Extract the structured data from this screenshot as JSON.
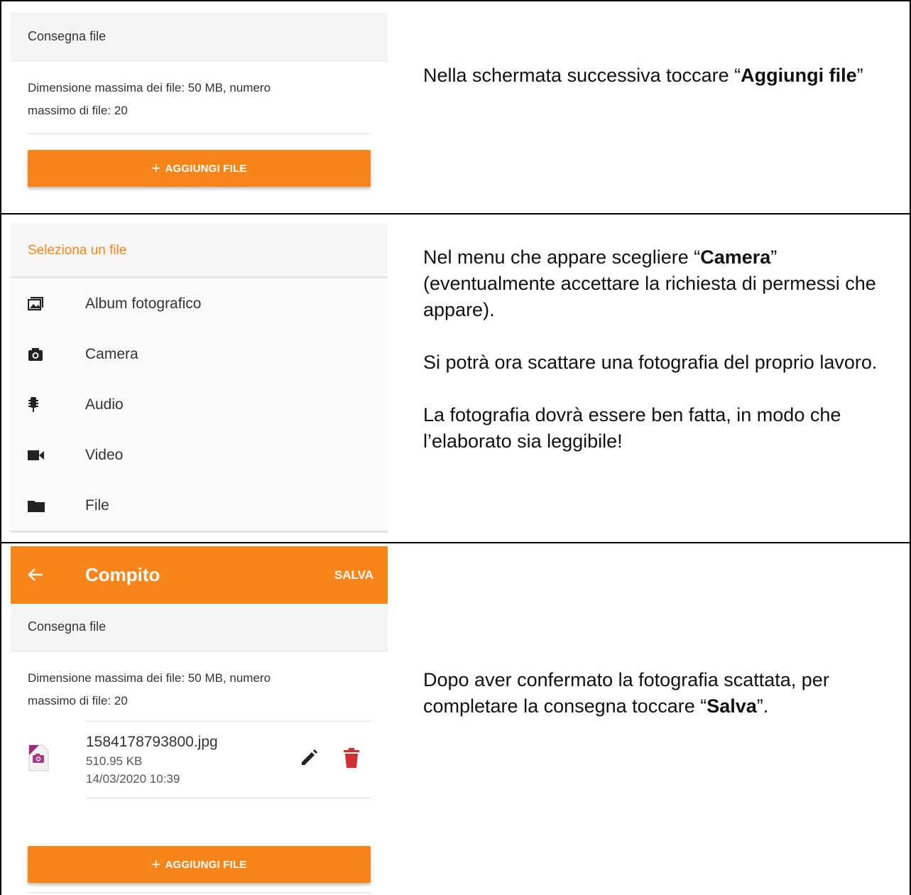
{
  "step1": {
    "section_header": "Consegna file",
    "info_line1": "Dimensione massima dei file: 50 MB, numero",
    "info_line2": "massimo di file: 20",
    "add_button_label": "AGGIUNGI FILE",
    "instruction_prefix": "Nella schermata successiva toccare “",
    "instruction_bold": "Aggiungi file",
    "instruction_suffix": "”"
  },
  "step2": {
    "menu_title": "Seleziona un file",
    "menu_items": [
      {
        "label": "Album fotografico",
        "icon": "photo-album-icon"
      },
      {
        "label": "Camera",
        "icon": "camera-icon"
      },
      {
        "label": "Audio",
        "icon": "microphone-icon"
      },
      {
        "label": "Video",
        "icon": "video-camera-icon"
      },
      {
        "label": "File",
        "icon": "folder-icon"
      }
    ],
    "para1_prefix": "Nel menu che appare scegliere “",
    "para1_bold": "Camera",
    "para1_suffix": "” (eventualmente accettare la richiesta di permessi che appare).",
    "para2": "Si potrà ora scattare una fotografia del proprio lavoro.",
    "para3": "La fotografia dovrà essere ben fatta, in modo che l’elaborato sia leggibile!"
  },
  "step3": {
    "appbar_title": "Compito",
    "appbar_action": "SALVA",
    "section_header": "Consegna file",
    "info_line1": "Dimensione massima dei file: 50 MB, numero",
    "info_line2": "massimo di file: 20",
    "file": {
      "name": "1584178793800.jpg",
      "size": "510.95 KB",
      "date": "14/03/2020 10:39"
    },
    "add_button_label": "AGGIUNGI FILE",
    "instruction_prefix": "Dopo aver confermato la fotografia scattata, per completare la consegna toccare “",
    "instruction_bold": "Salva",
    "instruction_suffix": "”."
  },
  "colors": {
    "accent": "#f7851a",
    "delete": "#d32f2f"
  }
}
